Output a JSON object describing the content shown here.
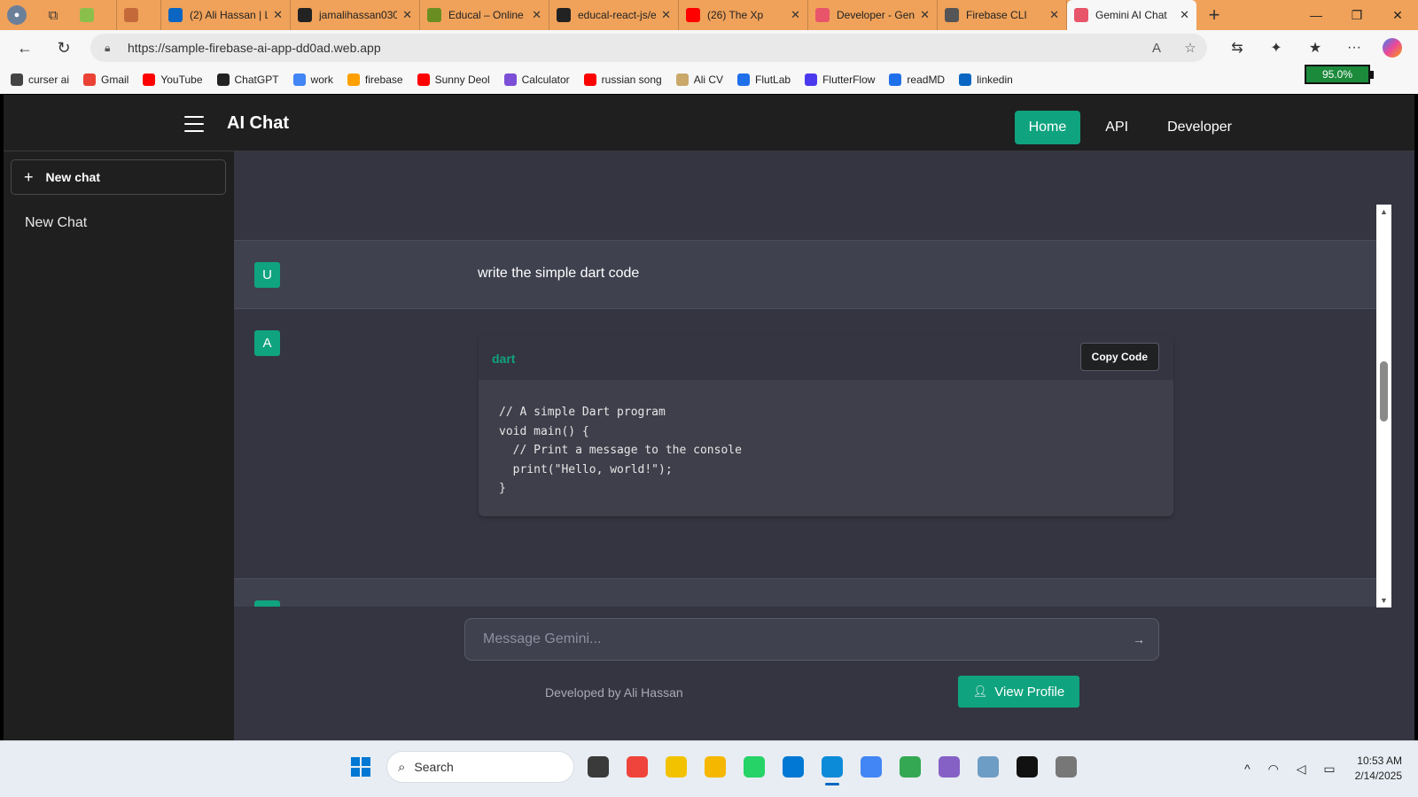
{
  "browser": {
    "tabs": [
      {
        "title": "",
        "favicon_color": "#8bbf4c",
        "width": 50
      },
      {
        "title": "",
        "favicon_color": "#c46a3a",
        "width": 50
      },
      {
        "title": "(2) Ali Hassan | L",
        "favicon_color": "#0a66c2",
        "width": 146
      },
      {
        "title": "jamalihassan030",
        "favicon_color": "#222222",
        "width": 146
      },
      {
        "title": "Educal – Online",
        "favicon_color": "#6b8e23",
        "width": 146
      },
      {
        "title": "educal-react-js/e",
        "favicon_color": "#222222",
        "width": 146
      },
      {
        "title": "(26) The Xp",
        "favicon_color": "#ff0000",
        "width": 146
      },
      {
        "title": "Developer - Gen",
        "favicon_color": "#e8546a",
        "width": 146
      },
      {
        "title": "Firebase CLI",
        "favicon_color": "#555555",
        "width": 146
      },
      {
        "title": "Gemini AI Chat",
        "favicon_color": "#e8546a",
        "width": 146,
        "active": true
      }
    ],
    "url": "https://sample-firebase-ai-app-dd0ad.web.app",
    "bookmarks": [
      {
        "label": "curser ai",
        "color": "#444444"
      },
      {
        "label": "Gmail",
        "color": "#ea4335"
      },
      {
        "label": "YouTube",
        "color": "#ff0000"
      },
      {
        "label": "ChatGPT",
        "color": "#222222"
      },
      {
        "label": "work",
        "color": "#4285f4"
      },
      {
        "label": "firebase",
        "color": "#ffa000"
      },
      {
        "label": "Sunny Deol",
        "color": "#ff0000"
      },
      {
        "label": "Calculator",
        "color": "#7b4fd6"
      },
      {
        "label": "russian song",
        "color": "#ff0000"
      },
      {
        "label": "Ali CV",
        "color": "#c9a86a"
      },
      {
        "label": "FlutLab",
        "color": "#1f6feb"
      },
      {
        "label": "FlutterFlow",
        "color": "#4b39ef"
      },
      {
        "label": "readMD",
        "color": "#1f6feb"
      },
      {
        "label": "linkedin",
        "color": "#0a66c2"
      }
    ],
    "battery_label": "95.0%"
  },
  "app": {
    "title": "AI Chat",
    "nav": {
      "home": "Home",
      "api": "API",
      "developer": "Developer"
    },
    "sidebar": {
      "new_chat_label": "New chat",
      "chats": [
        "New Chat"
      ]
    },
    "messages": {
      "user_avatar": "U",
      "user_text": "write the simple dart code",
      "ai_avatar": "A",
      "code_lang": "dart",
      "copy_label": "Copy Code",
      "code": "// A simple Dart program\nvoid main() {\n  // Print a message to the console\n  print(\"Hello, world!\");\n}"
    },
    "composer": {
      "placeholder": "Message Gemini..."
    },
    "footer": {
      "credit": "Developed by Ali Hassan",
      "profile_button": "View Profile"
    },
    "accent_color": "#10a37f"
  },
  "taskbar": {
    "search_label": "Search",
    "time": "10:53 AM",
    "date": "2/14/2025",
    "apps": [
      {
        "name": "file-explorer-dark",
        "color": "#3a3a3a"
      },
      {
        "name": "anydesk",
        "color": "#ef443b"
      },
      {
        "name": "app-yellow",
        "color": "#f2c200"
      },
      {
        "name": "file-explorer",
        "color": "#f5b700"
      },
      {
        "name": "whatsapp",
        "color": "#25d366"
      },
      {
        "name": "vscode",
        "color": "#0078d4"
      },
      {
        "name": "edge",
        "color": "#0c8bd8",
        "active": true
      },
      {
        "name": "chrome",
        "color": "#4285f4"
      },
      {
        "name": "chrome-canary",
        "color": "#34a853"
      },
      {
        "name": "visual-studio",
        "color": "#8661c5"
      },
      {
        "name": "photos",
        "color": "#6d9dc5"
      },
      {
        "name": "capcut",
        "color": "#111111"
      },
      {
        "name": "app-clock",
        "color": "#777777"
      }
    ]
  }
}
